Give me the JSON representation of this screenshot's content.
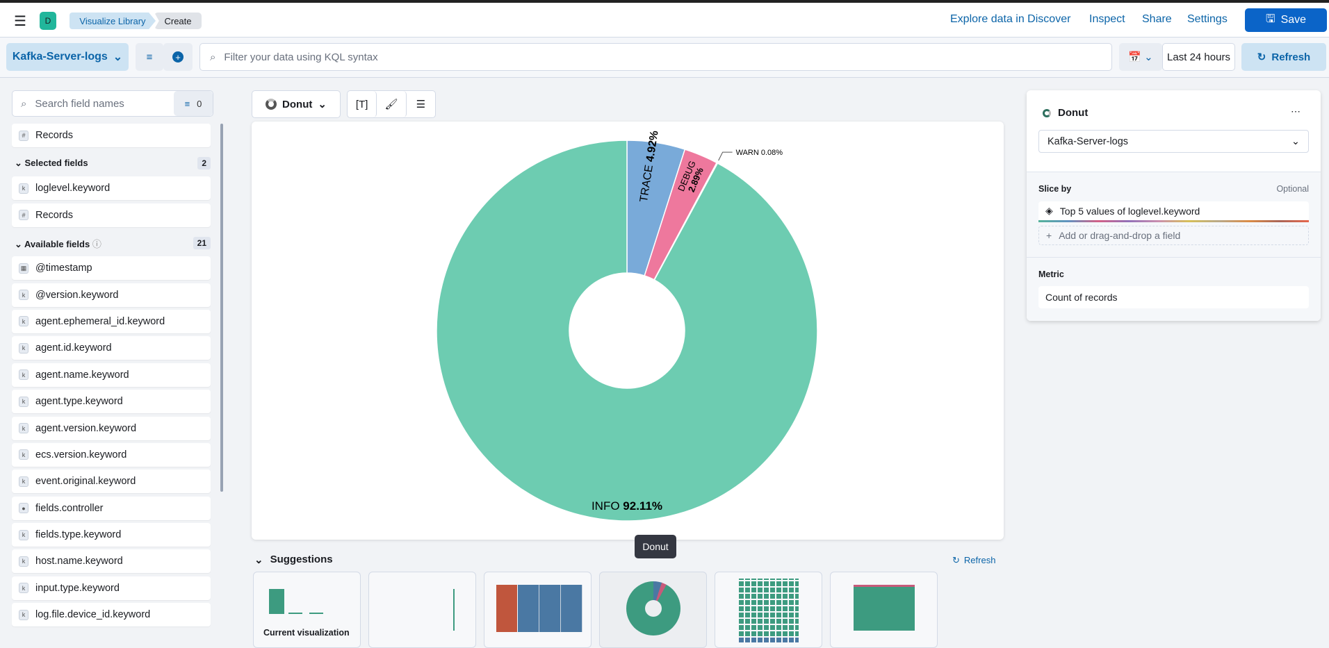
{
  "header": {
    "avatar": "D",
    "breadcrumbs": [
      "Visualize Library",
      "Create"
    ],
    "links": [
      "Explore data in Discover",
      "Inspect",
      "Share",
      "Settings"
    ],
    "save": "Save"
  },
  "query": {
    "dataview": "Kafka-Server-logs",
    "placeholder": "Filter your data using KQL syntax",
    "time": "Last 24 hours",
    "refresh": "Refresh"
  },
  "sidebar": {
    "search_placeholder": "Search field names",
    "filter_count": "0",
    "records": "Records",
    "selected_label": "Selected fields",
    "selected_count": "2",
    "selected": [
      {
        "name": "loglevel.keyword",
        "type": "k"
      },
      {
        "name": "Records",
        "type": "#"
      }
    ],
    "available_label": "Available fields",
    "available_count": "21",
    "available": [
      {
        "name": "@timestamp",
        "type": "date"
      },
      {
        "name": "@version.keyword",
        "type": "k"
      },
      {
        "name": "agent.ephemeral_id.keyword",
        "type": "k"
      },
      {
        "name": "agent.id.keyword",
        "type": "k"
      },
      {
        "name": "agent.name.keyword",
        "type": "k"
      },
      {
        "name": "agent.type.keyword",
        "type": "k"
      },
      {
        "name": "agent.version.keyword",
        "type": "k"
      },
      {
        "name": "ecs.version.keyword",
        "type": "k"
      },
      {
        "name": "event.original.keyword",
        "type": "k"
      },
      {
        "name": "fields.controller",
        "type": "other"
      },
      {
        "name": "fields.type.keyword",
        "type": "k"
      },
      {
        "name": "host.name.keyword",
        "type": "k"
      },
      {
        "name": "input.type.keyword",
        "type": "k"
      },
      {
        "name": "log.file.device_id.keyword",
        "type": "k"
      }
    ]
  },
  "toolbar": {
    "chart_type": "Donut"
  },
  "chart_data": {
    "type": "pie",
    "donut": true,
    "slices": [
      {
        "label": "TRACE",
        "value": 4.92,
        "color": "#79aad9"
      },
      {
        "label": "DEBUG",
        "value": 2.89,
        "color": "#ee789d"
      },
      {
        "label": "WARN",
        "value": 0.08,
        "color": "#a987d1"
      },
      {
        "label": "INFO",
        "value": 92.11,
        "color": "#6dccb1"
      }
    ]
  },
  "config": {
    "title": "Donut",
    "dataview": "Kafka-Server-logs",
    "slice_label": "Slice by",
    "optional": "Optional",
    "slice_value": "Top 5 values of loglevel.keyword",
    "add_field": "Add or drag-and-drop a field",
    "metric_label": "Metric",
    "metric_value": "Count of records"
  },
  "suggestions": {
    "title": "Suggestions",
    "refresh": "Refresh",
    "tooltip": "Donut",
    "current": "Current visualization"
  }
}
